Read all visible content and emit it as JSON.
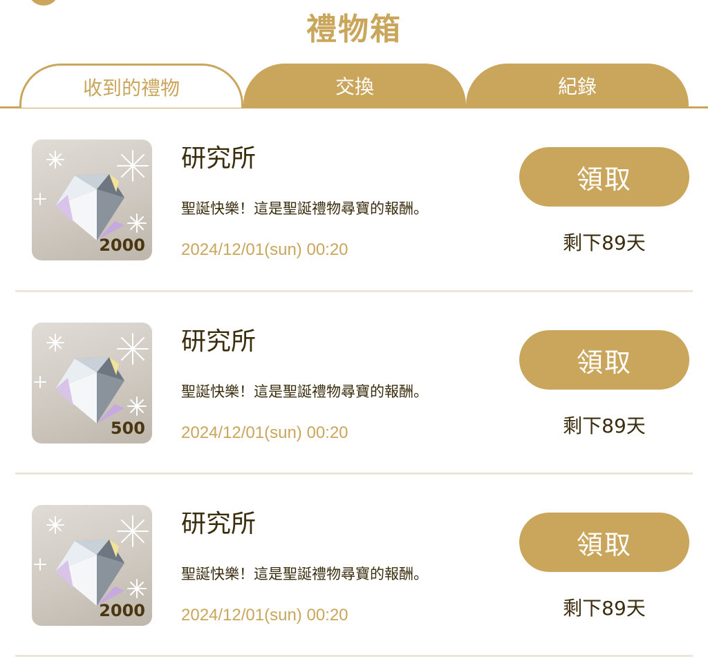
{
  "header": {
    "title": "禮物箱"
  },
  "tabs": [
    {
      "label": "收到的禮物",
      "active": true
    },
    {
      "label": "交換",
      "active": false
    },
    {
      "label": "紀錄",
      "active": false
    }
  ],
  "gifts": [
    {
      "sender": "研究所",
      "message": "聖誕快樂！這是聖誕禮物尋寶的報酬。",
      "date": "2024/12/01(sun) 00:20",
      "quantity": "2000",
      "icon": "diamond-icon",
      "claim_label": "領取",
      "remaining": "剩下89天"
    },
    {
      "sender": "研究所",
      "message": "聖誕快樂！這是聖誕禮物尋寶的報酬。",
      "date": "2024/12/01(sun) 00:20",
      "quantity": "500",
      "icon": "diamond-icon",
      "claim_label": "領取",
      "remaining": "剩下89天"
    },
    {
      "sender": "研究所",
      "message": "聖誕快樂！這是聖誕禮物尋寶的報酬。",
      "date": "2024/12/01(sun) 00:20",
      "quantity": "2000",
      "icon": "diamond-icon",
      "claim_label": "領取",
      "remaining": "剩下89天"
    }
  ],
  "colors": {
    "accent": "#c9a65c",
    "text_dark": "#3a2d0e",
    "divider": "#ece6d6"
  }
}
